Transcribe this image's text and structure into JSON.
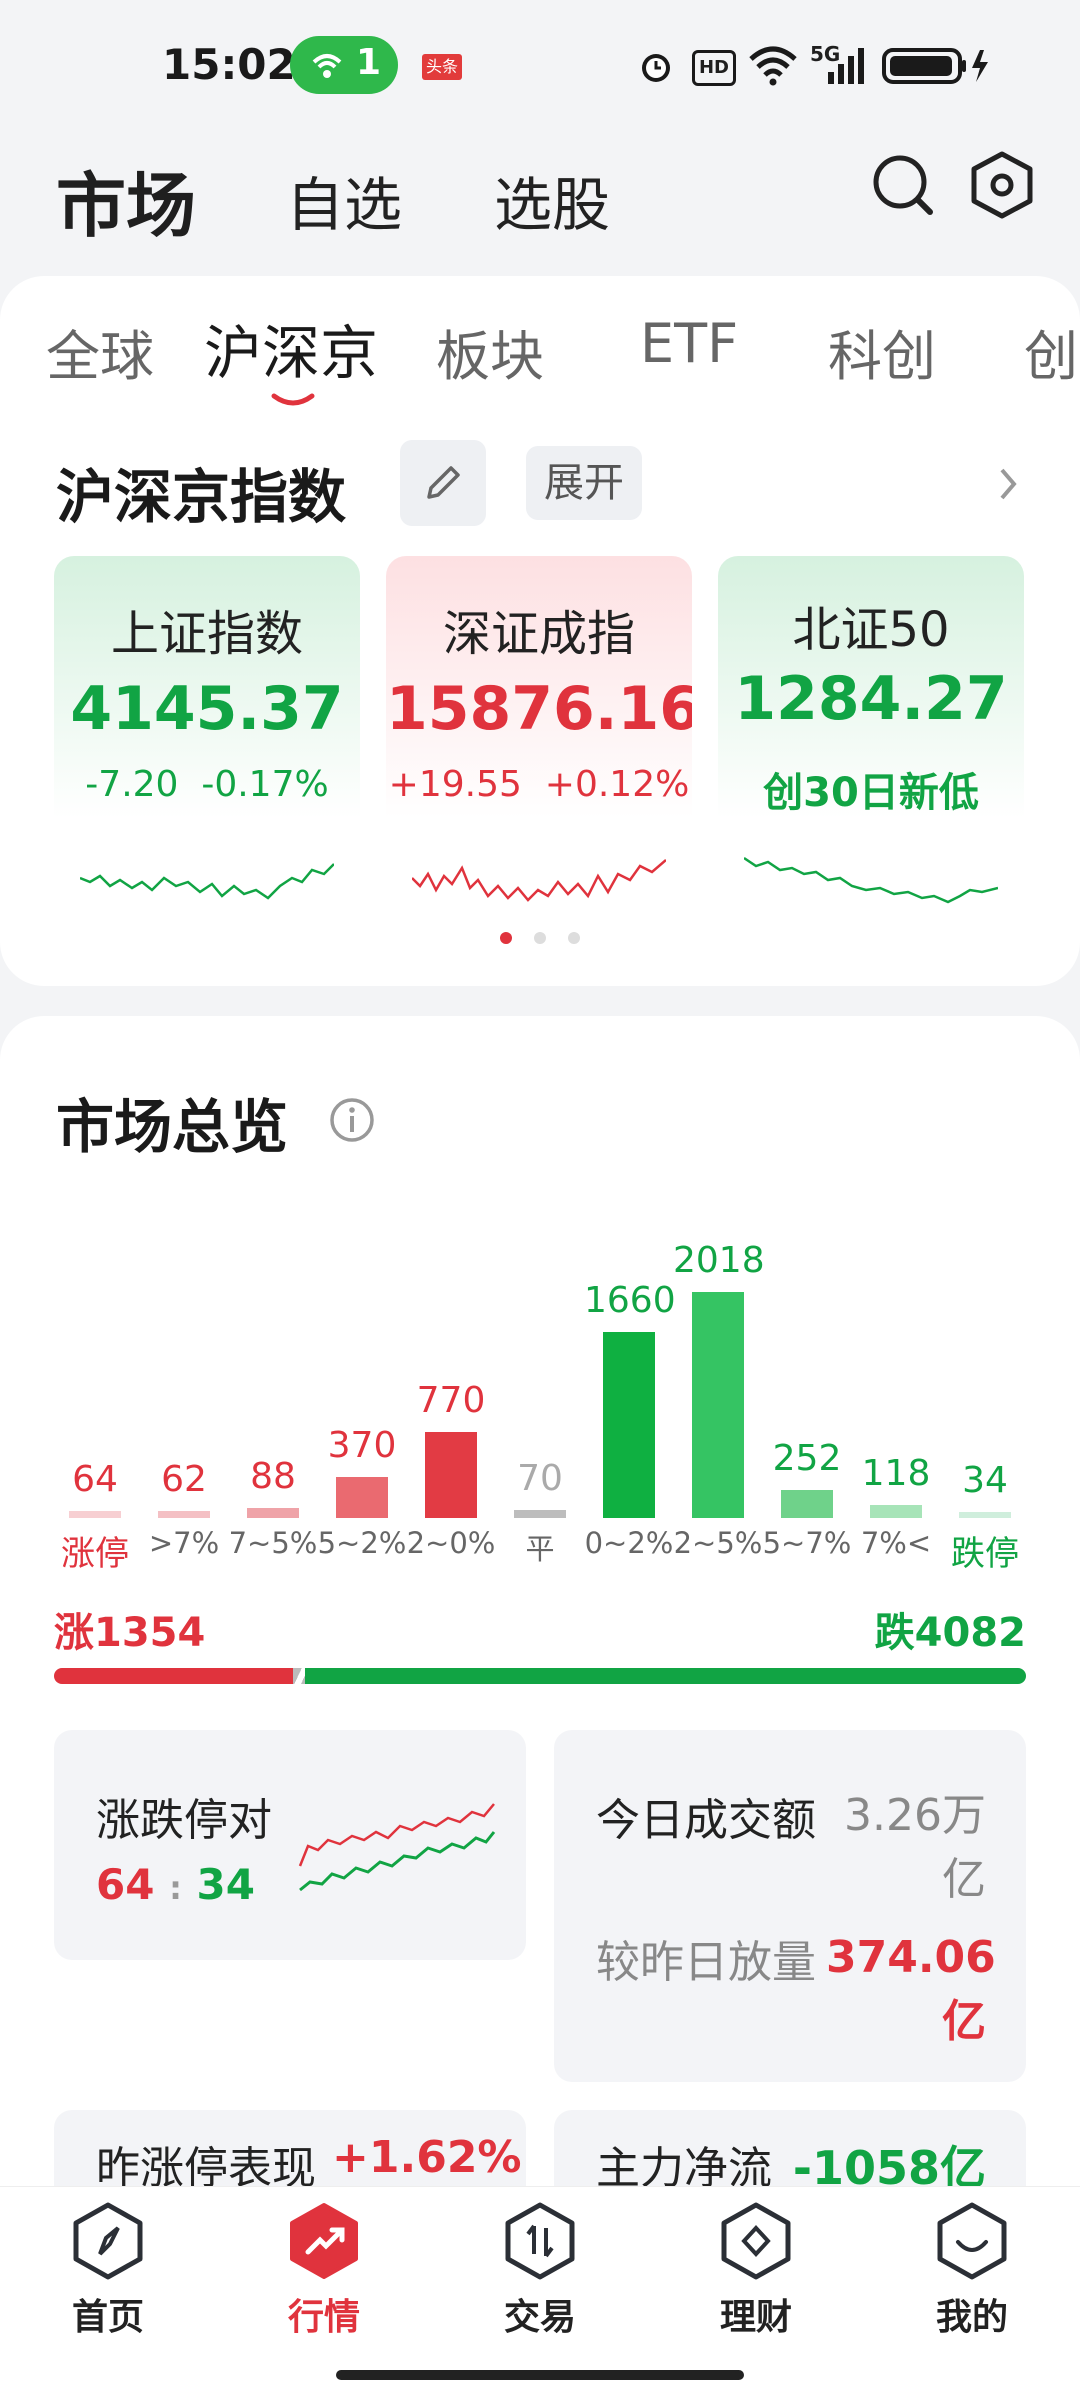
{
  "status_bar": {
    "time": "15:02",
    "hotspot_count": "1",
    "news_badge": "头条",
    "hd_label": "HD",
    "signal_label": "5G"
  },
  "header": {
    "title": "市场",
    "tabs": [
      "自选",
      "选股"
    ]
  },
  "market_tabs": [
    "全球",
    "沪深京",
    "板块",
    "ETF",
    "科创",
    "创"
  ],
  "index_section": {
    "title": "沪深京指数",
    "expand_label": "展开",
    "cards": [
      {
        "name": "上证指数",
        "value": "4145.37",
        "change": "-7.20",
        "pct": "-0.17%",
        "trend": "down"
      },
      {
        "name": "深证成指",
        "value": "15876.16",
        "change": "+19.55",
        "pct": "+0.12%",
        "trend": "up"
      },
      {
        "name": "北证50",
        "value": "1284.27",
        "note": "创30日新低",
        "trend": "down"
      }
    ]
  },
  "overview": {
    "title": "市场总览",
    "buckets": [
      {
        "label": "涨停",
        "value": 64,
        "side": "up"
      },
      {
        "label": ">7%",
        "value": 62,
        "side": "up"
      },
      {
        "label": "7~5%",
        "value": 88,
        "side": "up"
      },
      {
        "label": "5~2%",
        "value": 370,
        "side": "up"
      },
      {
        "label": "2~0%",
        "value": 770,
        "side": "up"
      },
      {
        "label": "平",
        "value": 70,
        "side": "flat"
      },
      {
        "label": "0~2%",
        "value": 1660,
        "side": "down"
      },
      {
        "label": "2~5%",
        "value": 2018,
        "side": "down"
      },
      {
        "label": "5~7%",
        "value": 252,
        "side": "down"
      },
      {
        "label": "7%<",
        "value": 118,
        "side": "down"
      },
      {
        "label": "跌停",
        "value": 34,
        "side": "down"
      }
    ],
    "up_total": "涨1354",
    "down_total": "跌4082",
    "limit_card": {
      "title": "涨跌停对",
      "up": "64",
      "sep": ":",
      "down": "34"
    },
    "turnover_card": {
      "label": "今日成交额",
      "value": "3.26万亿",
      "cmp_label": "较昨日放量",
      "cmp_value": "374.06亿"
    },
    "prev_limit": {
      "label": "昨涨停表现",
      "value": "+1.62%"
    },
    "main_flow": {
      "label": "主力净流",
      "value": "-1058亿"
    }
  },
  "bottom_nav": [
    {
      "label": "首页",
      "icon": "compass-icon"
    },
    {
      "label": "行情",
      "icon": "trend-icon",
      "active": true
    },
    {
      "label": "交易",
      "icon": "exchange-icon"
    },
    {
      "label": "理财",
      "icon": "diamond-icon"
    },
    {
      "label": "我的",
      "icon": "smile-icon"
    }
  ],
  "colors": {
    "up": "#e0333d",
    "down": "#11a444",
    "flat": "#b5b5b5"
  }
}
